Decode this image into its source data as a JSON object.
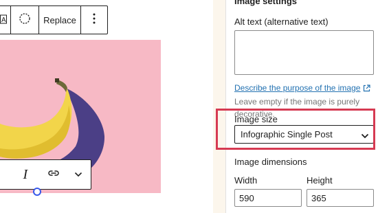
{
  "toolbar": {
    "align_glyph": "A|",
    "replace_label": "Replace",
    "more_glyph": "⋮",
    "icons": [
      "align-icon",
      "circle-dashed-icon",
      "more-vertical-icon"
    ]
  },
  "inline_toolbar": {
    "italic_glyph": "I",
    "icons": [
      "italic-icon",
      "link-icon",
      "chevron-down-icon"
    ]
  },
  "sidebar": {
    "panel_title": "Image settings",
    "alt": {
      "label": "Alt text (alternative text)",
      "value": "",
      "help_link": "Describe the purpose of the image",
      "help_text": "Leave empty if the image is purely decorative."
    },
    "image_size": {
      "label": "Image size",
      "selected": "Infographic Single Post"
    },
    "dimensions": {
      "label": "Image dimensions",
      "width_label": "Width",
      "height_label": "Height",
      "width_value": "590",
      "height_value": "365"
    }
  },
  "colors": {
    "image_background": "#f7b9c5",
    "highlight_border": "#d63a52",
    "link": "#2271b1",
    "handle": "#3858e9",
    "banana": "#f2d54a",
    "banana_shadow": "#4b3f86"
  }
}
